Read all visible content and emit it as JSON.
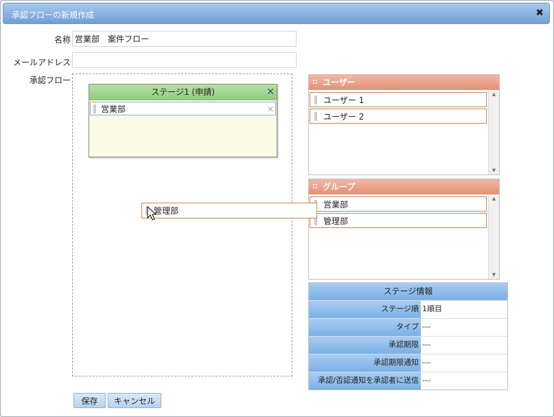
{
  "dialog": {
    "title": "承認フローの新規作成",
    "close_glyph": "✖"
  },
  "form": {
    "name_label": "名称",
    "name_value": "営業部　案件フロー",
    "email_label": "メールアドレス",
    "email_value": "",
    "flow_label": "承認フロー"
  },
  "stage": {
    "title": "ステージ1 (申請)",
    "close_glyph": "✕",
    "members": [
      {
        "name": "営業部",
        "remove_glyph": "✕"
      }
    ]
  },
  "dragging_item": {
    "name": "管理部"
  },
  "users_panel": {
    "title": "ユーザー",
    "items": [
      {
        "name": "ユーザー 1"
      },
      {
        "name": "ユーザー 2"
      }
    ]
  },
  "groups_panel": {
    "title": "グループ",
    "items": [
      {
        "name": "営業部"
      },
      {
        "name": "管理部"
      }
    ]
  },
  "stage_info": {
    "title": "ステージ情報",
    "rows": [
      {
        "key": "ステージ順",
        "value": "1順目"
      },
      {
        "key": "タイプ",
        "value": "---"
      },
      {
        "key": "承認期限",
        "value": "---"
      },
      {
        "key": "承認期限通知",
        "value": "---"
      },
      {
        "key": "承認/否認通知を承認者に送信",
        "value": "---"
      }
    ]
  },
  "buttons": {
    "save": "保存",
    "cancel": "キャンセル"
  }
}
